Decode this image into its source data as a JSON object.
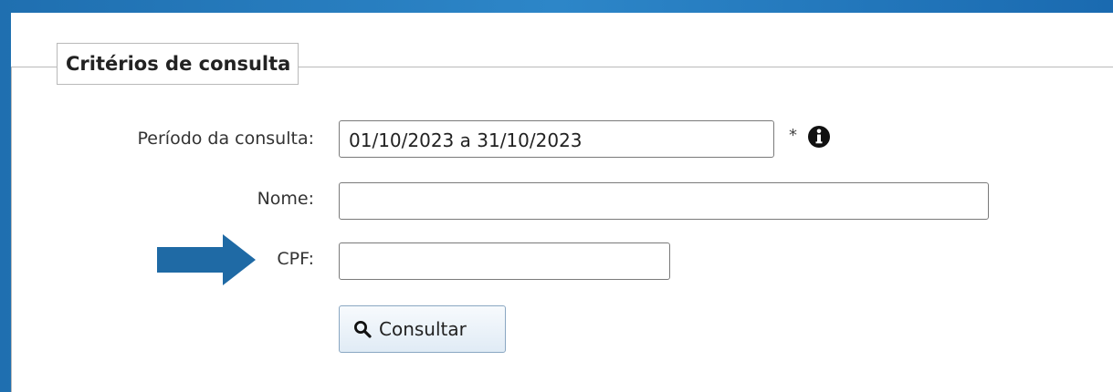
{
  "form": {
    "legend": "Critérios de consulta",
    "periodo": {
      "label": "Período da consulta:",
      "value": "01/10/2023 a 31/10/2023",
      "required_marker": "*"
    },
    "nome": {
      "label": "Nome:",
      "value": ""
    },
    "cpf": {
      "label": "CPF:",
      "value": ""
    },
    "submit_label": "Consultar"
  },
  "colors": {
    "background_blue": "#2d86c8",
    "arrow_blue": "#1f6aa5",
    "button_border": "#8aa7c2"
  },
  "icons": {
    "info": "info-icon",
    "search": "search-icon",
    "arrow": "arrow-right-icon"
  }
}
